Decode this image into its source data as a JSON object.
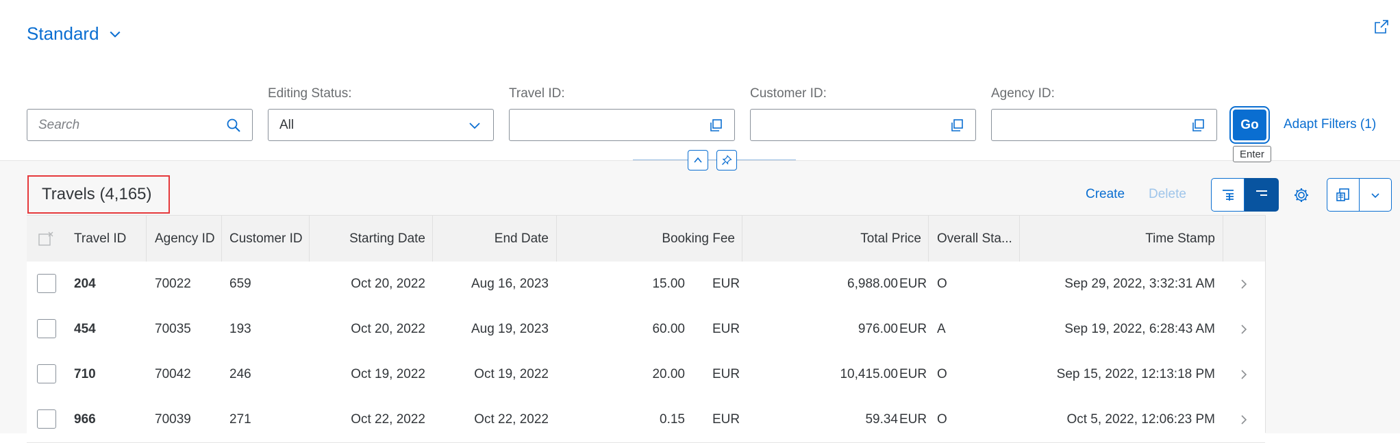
{
  "header": {
    "variant_label": "Standard",
    "icons": {
      "variant_dropdown": "chevron-down-icon",
      "share": "share-icon"
    }
  },
  "filters": {
    "search": {
      "placeholder": "Search",
      "value": ""
    },
    "editing_status": {
      "label": "Editing Status:",
      "value": "All"
    },
    "travel_id": {
      "label": "Travel ID:",
      "value": ""
    },
    "customer_id": {
      "label": "Customer ID:",
      "value": ""
    },
    "agency_id": {
      "label": "Agency ID:",
      "value": ""
    },
    "go_label": "Go",
    "go_tooltip": "Enter",
    "adapt_filters_label": "Adapt Filters (1)"
  },
  "toolbar": {
    "title": "Travels (4,165)",
    "create_label": "Create",
    "delete_label": "Delete"
  },
  "table": {
    "columns": [
      "Travel ID",
      "Agency ID",
      "Customer ID",
      "Starting Date",
      "End Date",
      "Booking Fee",
      "Total Price",
      "Overall Sta...",
      "Time Stamp"
    ],
    "rows": [
      {
        "travel_id": "204",
        "agency_id": "70022",
        "customer_id": "659",
        "start": "Oct 20, 2022",
        "end": "Aug 16, 2023",
        "fee": "15.00",
        "fee_cur": "EUR",
        "total": "6,988.00",
        "total_cur": "EUR",
        "status": "O",
        "timestamp": "Sep 29, 2022, 3:32:31 AM"
      },
      {
        "travel_id": "454",
        "agency_id": "70035",
        "customer_id": "193",
        "start": "Oct 20, 2022",
        "end": "Aug 19, 2023",
        "fee": "60.00",
        "fee_cur": "EUR",
        "total": "976.00",
        "total_cur": "EUR",
        "status": "A",
        "timestamp": "Sep 19, 2022, 6:28:43 AM"
      },
      {
        "travel_id": "710",
        "agency_id": "70042",
        "customer_id": "246",
        "start": "Oct 19, 2022",
        "end": "Oct 19, 2022",
        "fee": "20.00",
        "fee_cur": "EUR",
        "total": "10,415.00",
        "total_cur": "EUR",
        "status": "O",
        "timestamp": "Sep 15, 2022, 12:13:18 PM"
      },
      {
        "travel_id": "966",
        "agency_id": "70039",
        "customer_id": "271",
        "start": "Oct 22, 2022",
        "end": "Oct 22, 2022",
        "fee": "0.15",
        "fee_cur": "EUR",
        "total": "59.34",
        "total_cur": "EUR",
        "status": "O",
        "timestamp": "Oct 5, 2022, 12:06:23 PM"
      }
    ]
  },
  "colors": {
    "accent": "#0a6ed1",
    "highlight_border": "#e5383b"
  }
}
